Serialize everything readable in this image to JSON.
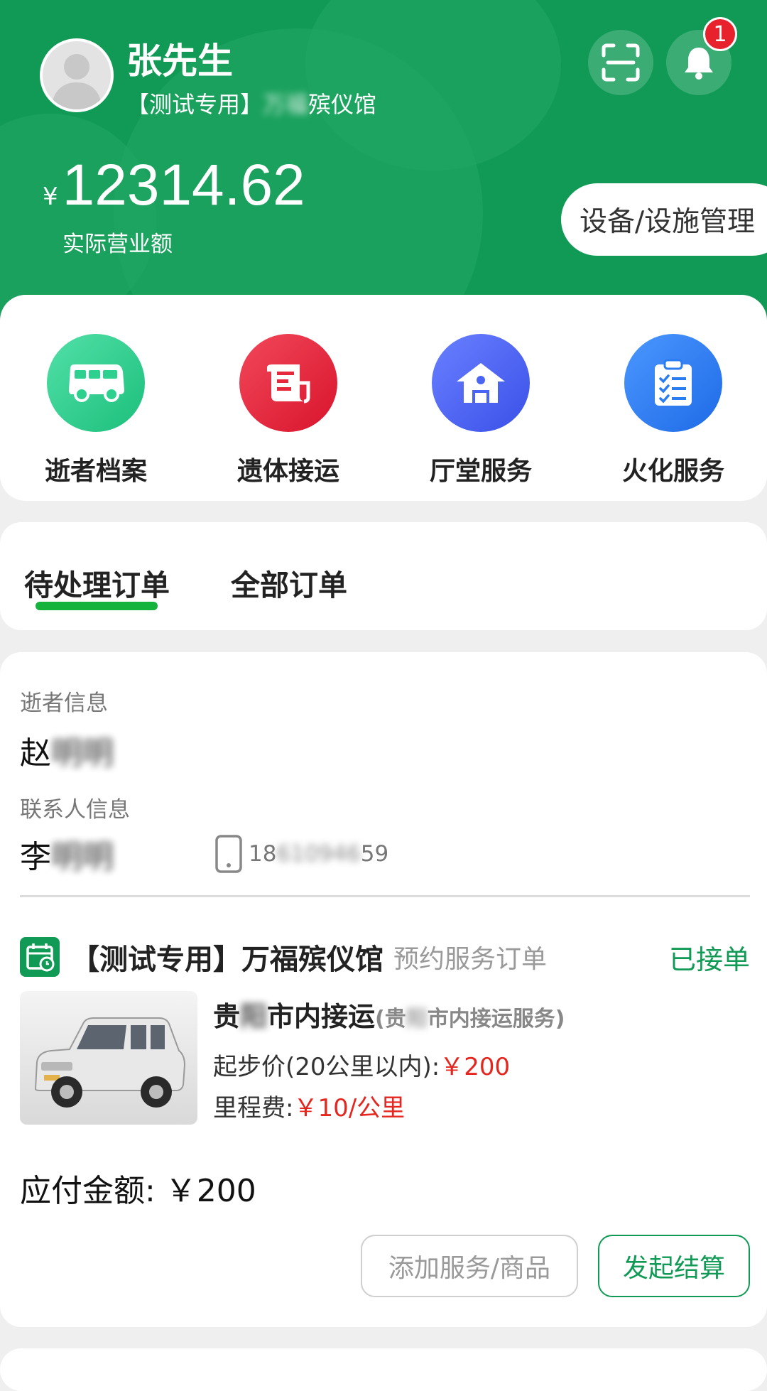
{
  "header": {
    "user_name": "张先生",
    "org_prefix": "【测试专用】",
    "org_hidden": "万福",
    "org_suffix": "殡仪馆",
    "notification_count": "1",
    "revenue_symbol": "¥",
    "revenue_value": "12314.62",
    "revenue_label": "实际营业额",
    "device_button": "设备/设施管理"
  },
  "quick_menu": [
    {
      "label": "逝者档案",
      "icon": "van-icon",
      "color": "#2ed08f"
    },
    {
      "label": "遗体接运",
      "icon": "scroll-icon",
      "color": "#e5283c"
    },
    {
      "label": "厅堂服务",
      "icon": "hall-icon",
      "color": "#4a64f5"
    },
    {
      "label": "火化服务",
      "icon": "clipboard-icon",
      "color": "#2a7cf0"
    }
  ],
  "tabs": [
    {
      "label": "待处理订单",
      "active": true
    },
    {
      "label": "全部订单",
      "active": false
    }
  ],
  "order": {
    "deceased_label": "逝者信息",
    "deceased_first": "赵",
    "deceased_hidden": "明明",
    "contact_label": "联系人信息",
    "contact_first": "李",
    "contact_hidden": "明明",
    "phone_start": "18",
    "phone_hidden": "610946",
    "phone_end": "59",
    "org_title": "【测试专用】万福殡仪馆",
    "order_type": "预约服务订单",
    "status": "已接单",
    "service_prefix": "贵",
    "service_hidden": "阳",
    "service_suffix": "市内接运",
    "service_sub_prefix": "(贵",
    "service_sub_hidden": "阳",
    "service_sub_suffix": "市内接运服务)",
    "base_price_label": "起步价(20公里以内):",
    "base_price_value": "￥200",
    "mileage_label": "里程费:",
    "mileage_value": "￥10/公里",
    "amount_label": "应付金额: ￥200",
    "add_button": "添加服务/商品",
    "settle_button": "发起结算"
  },
  "colors": {
    "brand_green": "#109a55",
    "tab_indicator": "#14b33c",
    "price_red": "#e4261f",
    "badge_red": "#e8222d"
  }
}
